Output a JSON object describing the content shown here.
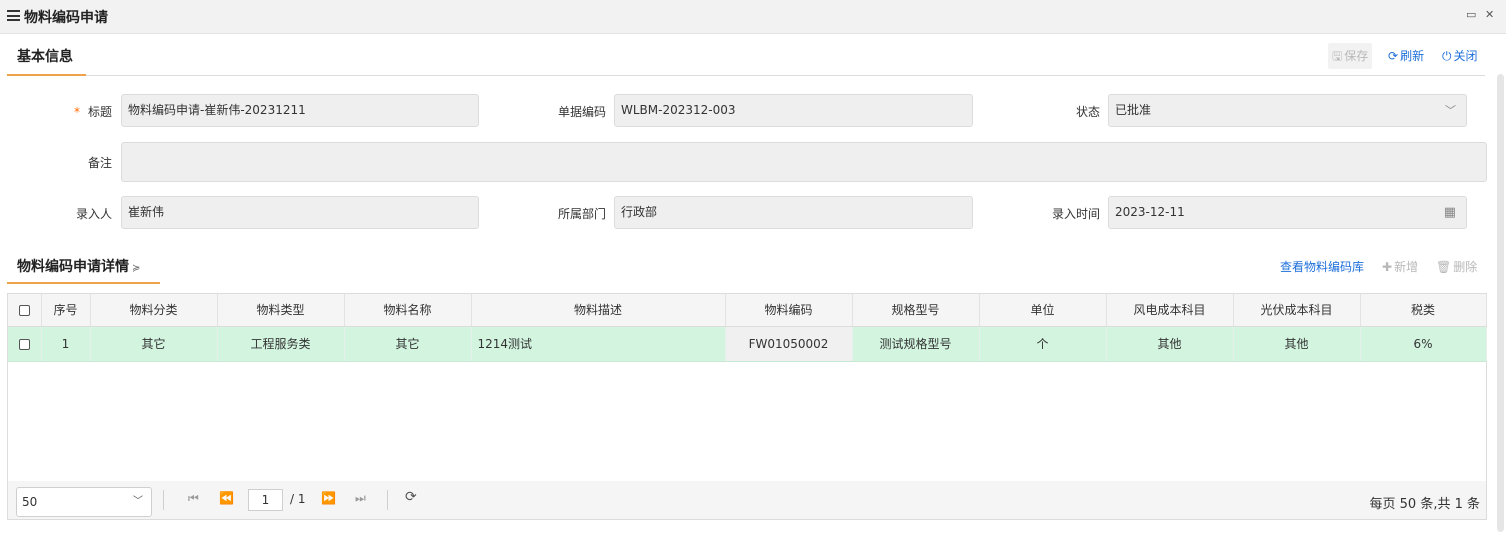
{
  "window": {
    "title": "物料编码申请",
    "maximize_icon": "maximize-icon",
    "close_icon": "close-icon"
  },
  "basic_info": {
    "title": "基本信息",
    "toolbar": {
      "save": "保存",
      "refresh": "刷新",
      "close": "关闭"
    }
  },
  "form": {
    "title_label": "标题",
    "title_value": "物料编码申请-崔新伟-20231211",
    "doc_code_label": "单据编码",
    "doc_code_value": "WLBM-202312-003",
    "status_label": "状态",
    "status_value": "已批准",
    "remark_label": "备注",
    "remark_value": "",
    "entered_by_label": "录入人",
    "entered_by_value": "崔新伟",
    "department_label": "所属部门",
    "department_value": "行政部",
    "entry_time_label": "录入时间",
    "entry_time_value": "2023-12-11"
  },
  "details": {
    "title": "物料编码申请详情",
    "toolbar": {
      "view_library": "查看物料编码库",
      "add": "新增",
      "delete": "删除"
    },
    "columns": [
      "序号",
      "物料分类",
      "物料类型",
      "物料名称",
      "物料描述",
      "物料编码",
      "规格型号",
      "单位",
      "风电成本科目",
      "光伏成本科目",
      "税类"
    ],
    "rows": [
      [
        "1",
        "其它",
        "工程服务类",
        "其它",
        "1214测试",
        "FW01050002",
        "测试规格型号",
        "个",
        "其他",
        "其他",
        "6%"
      ]
    ]
  },
  "pager": {
    "page_size": "50",
    "current_page": "1",
    "total_pages": "/ 1",
    "summary": "每页 50 条,共 1 条"
  },
  "colors": {
    "accent_underline": "#f0a24a",
    "link_blue": "#1e6fd9",
    "selected_row": "#d3f5e0",
    "required_star": "#ff6a00"
  }
}
